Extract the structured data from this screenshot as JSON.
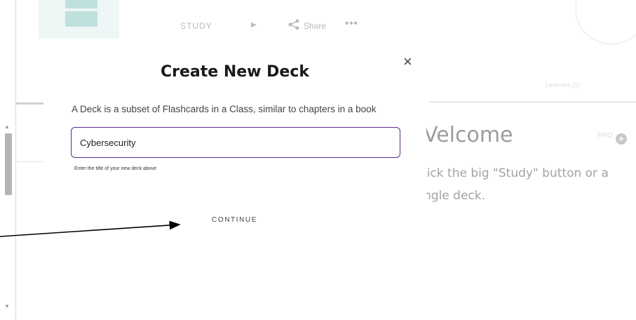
{
  "background": {
    "nav": {
      "study": "STUDY",
      "share": "Share",
      "more": "•••",
      "play": "▶"
    },
    "learners": "Learners (1)",
    "welcome": "Velcome",
    "pro": "PRO",
    "plus": "+",
    "description": [
      "lick the big \"Study\" button or a",
      "ngle deck."
    ]
  },
  "modal": {
    "close": "×",
    "title": "Create New Deck",
    "subtitle": "A Deck is a subset of Flashcards in a Class, similar to chapters in a book",
    "input_value": "Cybersecurity",
    "hint": "Enter the title of your new deck above",
    "continue": "CONTINUE"
  },
  "scrollbar": {
    "up": "▲",
    "down": "▼"
  },
  "colors": {
    "input_border": "#5b2b8c",
    "logo_accent": "#bfe0dc"
  },
  "icons": [
    "share-icon",
    "play-icon",
    "more-icon",
    "close-icon",
    "plus-icon",
    "arrow-annotation"
  ]
}
